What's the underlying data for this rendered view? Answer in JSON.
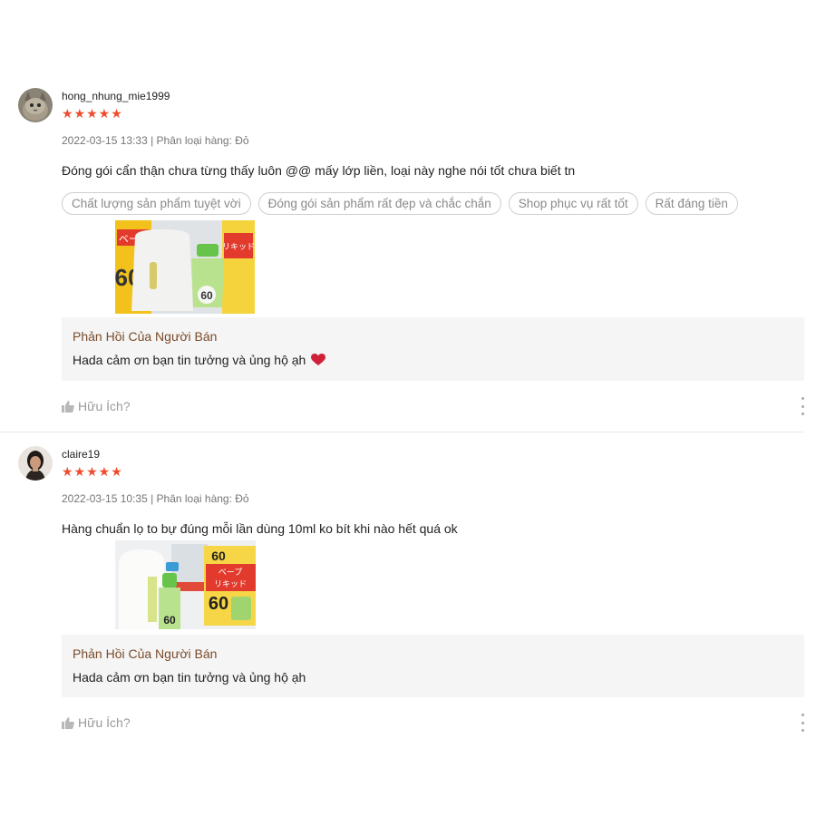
{
  "reviews": [
    {
      "username": "hong_nhung_mie1999",
      "stars": "★★★★★",
      "meta": "2022-03-15 13:33 | Phân loại hàng: Đỏ",
      "comment": "Đóng gói cẩn thận chưa từng thấy luôn @@ mấy lớp liền, loại này nghe nói tốt chưa biết tn",
      "tags": [
        "Chất lượng sản phẩm tuyệt vời",
        "Đóng gói sản phẩm rất đẹp và chắc chắn",
        "Shop phục vụ rất tốt",
        "Rất đáng tiền"
      ],
      "product_image": {
        "box_text_top": "ベープ",
        "box_text_mid": "リキッド",
        "count": "60"
      },
      "reply_title": "Phản Hồi Của Người Bán",
      "reply_text": "Hada cảm ơn bạn tin tưởng và ủng hộ ạh",
      "reply_icon": "heart-icon",
      "helpful": "Hữu Ích?"
    },
    {
      "username": "claire19",
      "stars": "★★★★★",
      "meta": "2022-03-15 10:35 | Phân loại hàng: Đỏ",
      "comment": "Hàng chuẩn lọ to bự đúng mỗi lần dùng 10ml ko bít khi nào hết quá ok",
      "tags": [],
      "product_image": {
        "box_text_top": "ベープ",
        "box_text_mid": "リキッド",
        "count": "60"
      },
      "reply_title": "Phản Hồi Của Người Bán",
      "reply_text": "Hada cảm ơn bạn tin tưởng và ủng hộ ạh",
      "helpful": "Hữu Ích?"
    }
  ],
  "colors": {
    "star": "#ee4d2d",
    "reply_title": "#7a4b2a",
    "reply_bg": "#f5f5f5",
    "heart": "#d0213a"
  }
}
